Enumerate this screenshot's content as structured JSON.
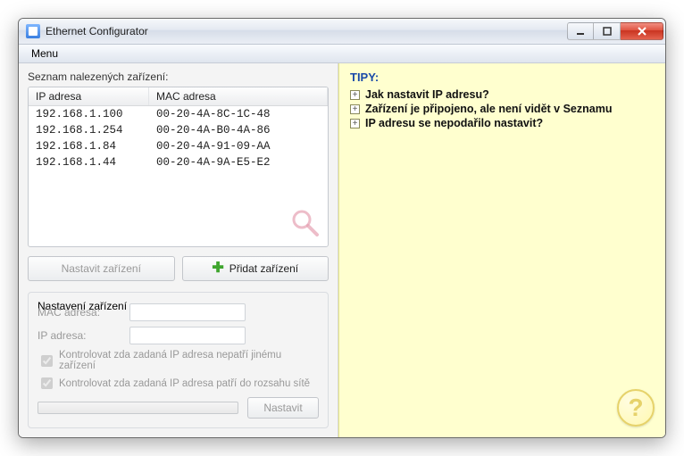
{
  "window": {
    "title": "Ethernet Configurator"
  },
  "menubar": {
    "items": [
      {
        "label": "Menu"
      }
    ]
  },
  "left": {
    "list_label": "Seznam nalezených zařízení:",
    "headers": {
      "ip": "IP adresa",
      "mac": "MAC adresa"
    },
    "rows": [
      {
        "ip": "192.168.1.100",
        "mac": "00-20-4A-8C-1C-48"
      },
      {
        "ip": "192.168.1.254",
        "mac": "00-20-4A-B0-4A-86"
      },
      {
        "ip": "192.168.1.84",
        "mac": "00-20-4A-91-09-AA"
      },
      {
        "ip": "192.168.1.44",
        "mac": "00-20-4A-9A-E5-E2"
      }
    ],
    "buttons": {
      "configure": "Nastavit zařízení",
      "add": "Přidat zařízení"
    },
    "settings": {
      "legend": "Nastavení zařízení",
      "mac_label": "MAC adresa:",
      "mac_value": "",
      "ip_label": "IP adresa:",
      "ip_value": "",
      "check_conflict": "Kontrolovat zda zadaná IP adresa nepatří jinému zařízení",
      "check_range": "Kontrolovat zda zadaná IP adresa patří do rozsahu sítě",
      "set_button": "Nastavit"
    }
  },
  "right": {
    "header": "TIPY:",
    "tips": [
      "Jak nastavit IP adresu?",
      "Zařízení je připojeno, ale není vidět v Seznamu",
      "IP adresu se nepodařilo nastavit?"
    ],
    "help": "?"
  }
}
